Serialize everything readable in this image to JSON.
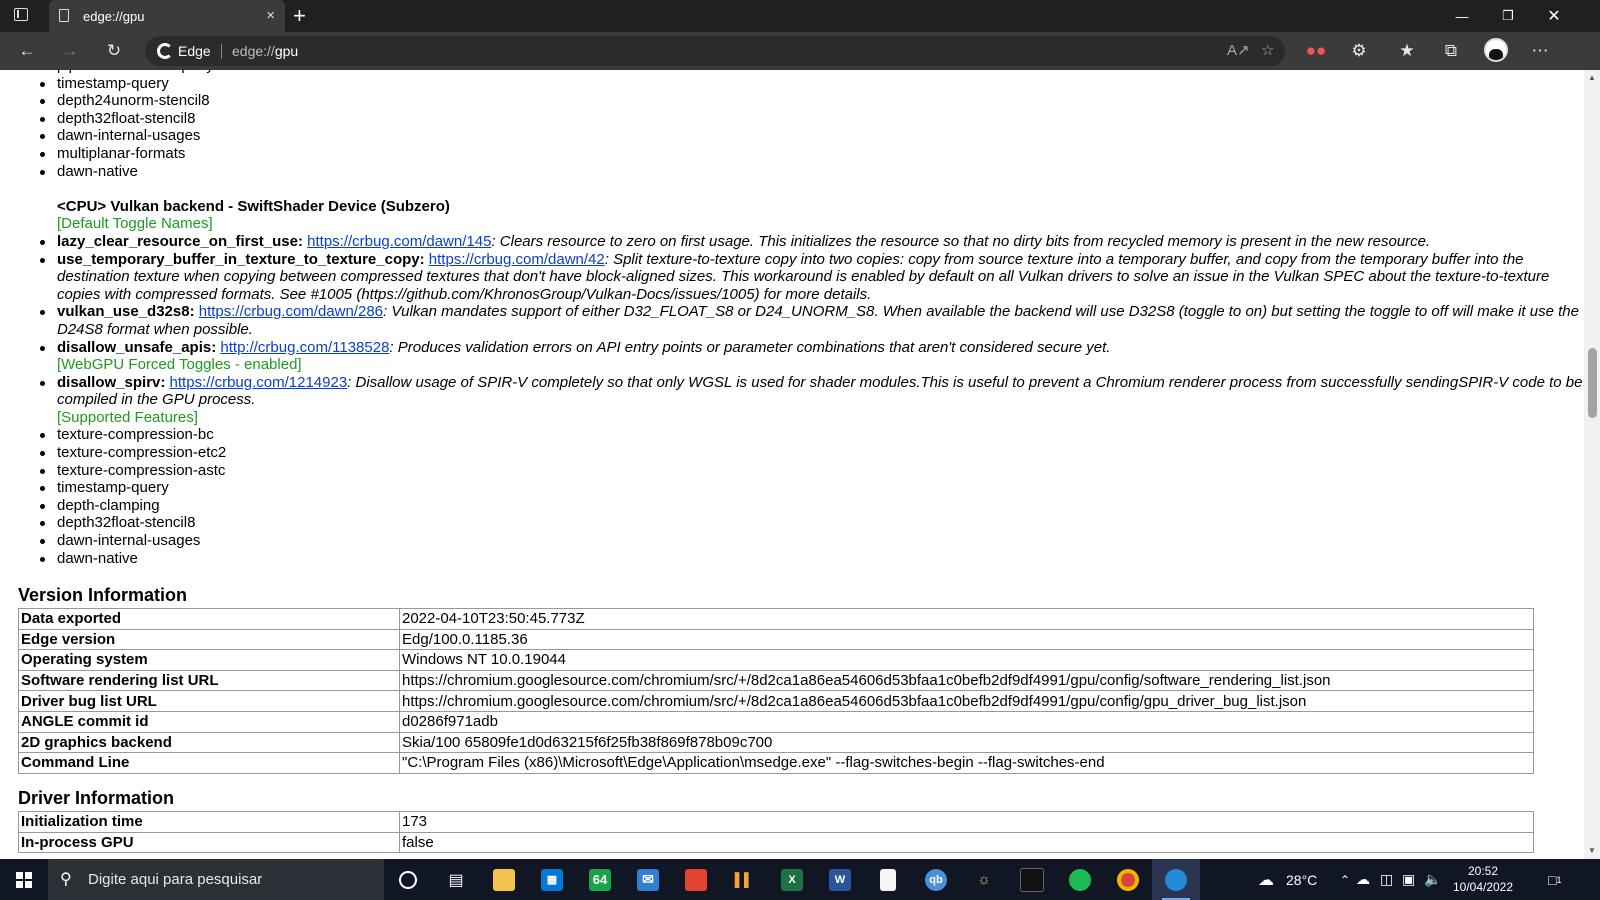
{
  "browser": {
    "tab_title": "edge://gpu",
    "brand": "Edge",
    "url_prefix": "edge://",
    "url_path": "gpu",
    "new_tab_symbol": "+",
    "tab_close_symbol": "×"
  },
  "content": {
    "cut_off_item": "pipeline-statistics-query",
    "top_features": [
      "timestamp-query",
      "depth24unorm-stencil8",
      "depth32float-stencil8",
      "dawn-internal-usages",
      "multiplanar-formats",
      "dawn-native"
    ],
    "device_heading": "<CPU> Vulkan backend - SwiftShader Device (Subzero)",
    "default_toggles_label": "[Default Toggle Names]",
    "toggles": [
      {
        "name": "lazy_clear_resource_on_first_use:",
        "link": "https://crbug.com/dawn/145",
        "desc": ": Clears resource to zero on first usage. This initializes the resource so that no dirty bits from recycled memory is present in the new resource."
      },
      {
        "name": "use_temporary_buffer_in_texture_to_texture_copy:",
        "link": "https://crbug.com/dawn/42",
        "desc": ": Split texture-to-texture copy into two copies: copy from source texture into a temporary buffer, and copy from the temporary buffer into the destination texture when copying between compressed textures that don't have block-aligned sizes. This workaround is enabled by default on all Vulkan drivers to solve an issue in the Vulkan SPEC about the texture-to-texture copies with compressed formats. See #1005 (https://github.com/KhronosGroup/Vulkan-Docs/issues/1005) for more details."
      },
      {
        "name": "vulkan_use_d32s8:",
        "link": "https://crbug.com/dawn/286",
        "desc": ": Vulkan mandates support of either D32_FLOAT_S8 or D24_UNORM_S8. When available the backend will use D32S8 (toggle to on) but setting the toggle to off will make it use the D24S8 format when possible."
      },
      {
        "name": "disallow_unsafe_apis:",
        "link": "http://crbug.com/1138528",
        "desc": ": Produces validation errors on API entry points or parameter combinations that aren't considered secure yet."
      }
    ],
    "forced_toggles_label": "[WebGPU Forced Toggles - enabled]",
    "forced_toggle": {
      "name": "disallow_spirv:",
      "link": "https://crbug.com/1214923",
      "desc": ": Disallow usage of SPIR-V completely so that only WGSL is used for shader modules.This is useful to prevent a Chromium renderer process from successfully sendingSPIR-V code to be compiled in the GPU process."
    },
    "supported_features_label": "[Supported Features]",
    "supported_features": [
      "texture-compression-bc",
      "texture-compression-etc2",
      "texture-compression-astc",
      "timestamp-query",
      "depth-clamping",
      "depth32float-stencil8",
      "dawn-internal-usages",
      "dawn-native"
    ]
  },
  "version_info": {
    "title": "Version Information",
    "rows": [
      {
        "key": "Data exported",
        "value": "2022-04-10T23:50:45.773Z"
      },
      {
        "key": "Edge version",
        "value": "Edg/100.0.1185.36"
      },
      {
        "key": "Operating system",
        "value": "Windows NT 10.0.19044"
      },
      {
        "key": "Software rendering list URL",
        "value": "https://chromium.googlesource.com/chromium/src/+/8d2ca1a86ea54606d53bfaa1c0befb2df9df4991/gpu/config/software_rendering_list.json"
      },
      {
        "key": "Driver bug list URL",
        "value": "https://chromium.googlesource.com/chromium/src/+/8d2ca1a86ea54606d53bfaa1c0befb2df9df4991/gpu/config/gpu_driver_bug_list.json"
      },
      {
        "key": "ANGLE commit id",
        "value": "d0286f971adb"
      },
      {
        "key": "2D graphics backend",
        "value": "Skia/100 65809fe1d0d63215f6f25fb38f869f878b09c700"
      },
      {
        "key": "Command Line",
        "value": "\"C:\\Program Files (x86)\\Microsoft\\Edge\\Application\\msedge.exe\" --flag-switches-begin --flag-switches-end"
      }
    ]
  },
  "driver_info": {
    "title": "Driver Information",
    "rows": [
      {
        "key": "Initialization time",
        "value": "173"
      },
      {
        "key": "In-process GPU",
        "value": "false"
      }
    ]
  },
  "taskbar": {
    "search_placeholder": "Digite aqui para pesquisar",
    "counter_badge": "64",
    "qb_label": "qb",
    "excel_letter": "X",
    "word_letter": "W",
    "weather": "28°C",
    "time": "20:52",
    "date": "10/04/2022",
    "notification_count": "1"
  },
  "colors": {
    "titlebar": "#202020",
    "toolbar": "#3b3b3b",
    "taskbar": "#101623",
    "link": "#0b3bd6",
    "green_label": "#1f9a1f"
  }
}
